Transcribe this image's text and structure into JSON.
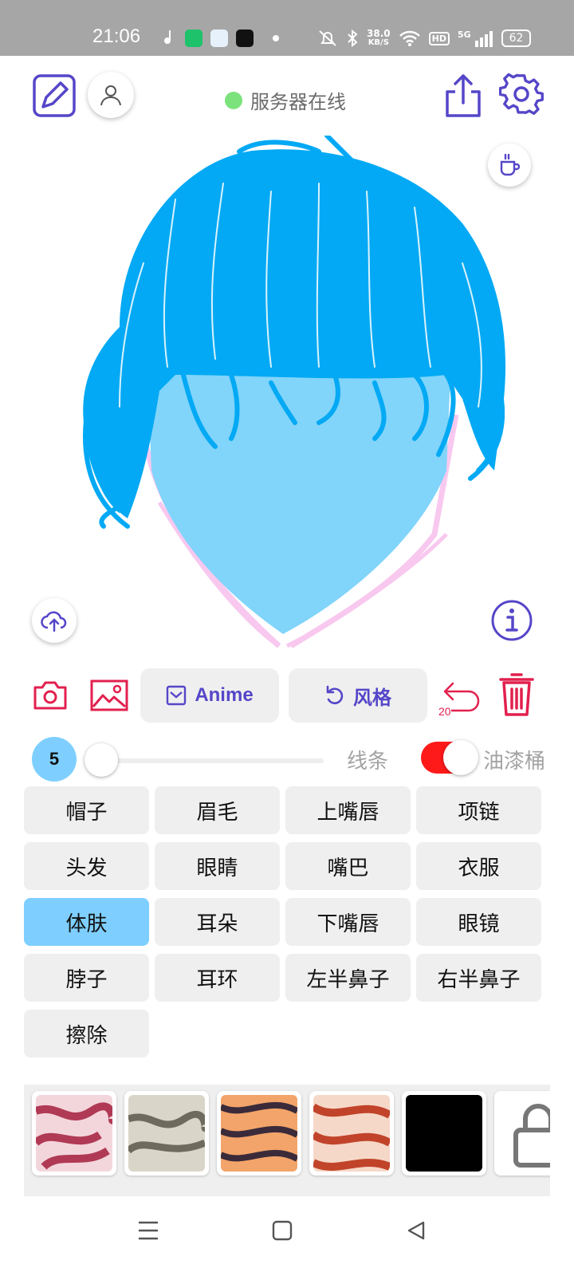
{
  "status_bar": {
    "time": "21:06",
    "net_speed_value": "38.0",
    "net_speed_unit": "KB/S",
    "hd": "HD",
    "signal": "5G",
    "battery": "62"
  },
  "header": {
    "server_status": "服务器在线",
    "status_color": "#7ce27c"
  },
  "actions": {
    "style_mode_label": "Anime",
    "style_label": "风格",
    "undo_count": "20"
  },
  "brush": {
    "size": "5",
    "lines_label": "线条",
    "bucket_label": "油漆桶",
    "bucket_enabled": true
  },
  "parts": [
    {
      "label": "帽子"
    },
    {
      "label": "眉毛"
    },
    {
      "label": "上嘴唇"
    },
    {
      "label": "项链"
    },
    {
      "label": "头发"
    },
    {
      "label": "眼睛"
    },
    {
      "label": "嘴巴"
    },
    {
      "label": "衣服"
    },
    {
      "label": "体肤",
      "active": true
    },
    {
      "label": "耳朵"
    },
    {
      "label": "下嘴唇"
    },
    {
      "label": "眼镜"
    },
    {
      "label": "脖子"
    },
    {
      "label": "耳环"
    },
    {
      "label": "左半鼻子"
    },
    {
      "label": "右半鼻子"
    },
    {
      "label": "擦除"
    }
  ],
  "textures": [
    {
      "name": "pink-marble",
      "base": "#f3d6dc",
      "ink": "#b03a55"
    },
    {
      "name": "gray-marble",
      "base": "#d9d5c9",
      "ink": "#6f6a5e"
    },
    {
      "name": "orange-tiger",
      "base": "#f3a46a",
      "ink": "#3b2b3a"
    },
    {
      "name": "red-tiger",
      "base": "#f6d8c8",
      "ink": "#c1442a"
    },
    {
      "name": "black",
      "base": "#000000",
      "ink": "#000000"
    },
    {
      "name": "locked"
    }
  ],
  "colors": {
    "accent": "#5546c8",
    "hair": "#03a9f4",
    "skin": "#81d4fa",
    "outline": "#f8c8ef",
    "danger": "#e2204e"
  }
}
